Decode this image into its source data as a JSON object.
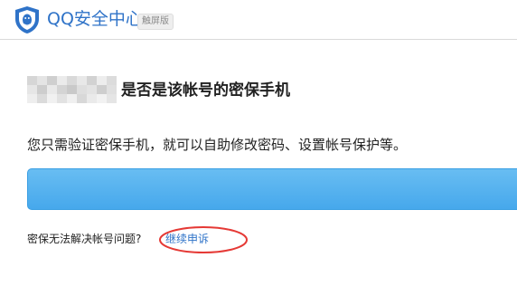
{
  "header": {
    "title": "QQ安全中心",
    "badge": "触屏版"
  },
  "main": {
    "heading": "是否是该帐号的密保手机",
    "description": "您只需验证密保手机，就可以自助修改密码、设置帐号保护等。",
    "help_text": "密保无法解决帐号问题?",
    "appeal_link": "继续申诉"
  },
  "colors": {
    "brand_blue": "#2f73c8",
    "button_blue": "#4aa9ee",
    "annotation_red": "#e53935"
  }
}
